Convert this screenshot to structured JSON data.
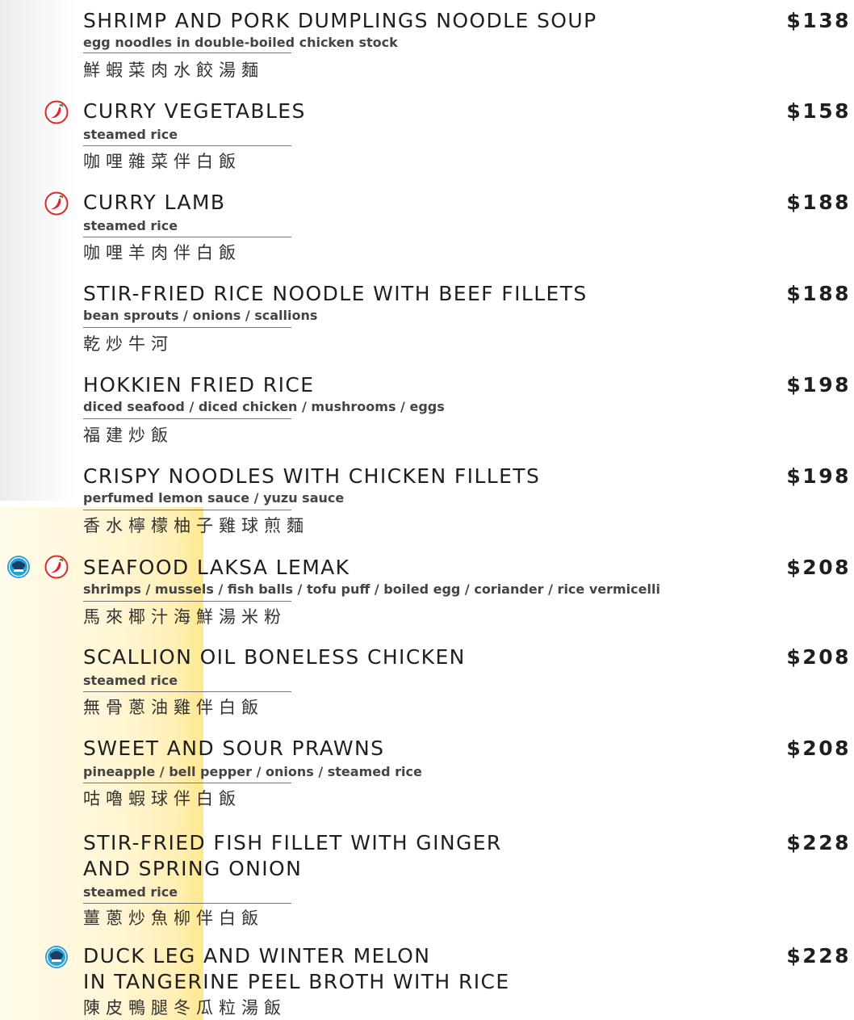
{
  "items": [
    {
      "title": "SHRIMP AND PORK DUMPLINGS NOODLE SOUP",
      "price": "$138",
      "desc": "egg noodles in double-boiled chicken stock",
      "cn": "鮮蝦菜肉水餃湯麵"
    },
    {
      "title": "CURRY VEGETABLES",
      "price": "$158",
      "desc": "steamed rice",
      "cn": "咖哩雜菜伴白飯",
      "icon": "chili-icon"
    },
    {
      "title": "CURRY LAMB",
      "price": "$188",
      "desc": "steamed rice",
      "cn": "咖哩羊肉伴白飯",
      "icon": "chili-icon"
    },
    {
      "title": "STIR-FRIED RICE NOODLE WITH BEEF FILLETS",
      "price": "$188",
      "desc": "bean sprouts / onions / scallions",
      "cn": "乾炒牛河"
    },
    {
      "title": "HOKKIEN FRIED RICE",
      "price": "$198",
      "desc": "diced seafood / diced chicken / mushrooms / eggs",
      "cn": "福建炒飯"
    },
    {
      "title": "CRISPY NOODLES WITH CHICKEN FILLETS",
      "price": "$198",
      "desc": "perfumed lemon sauce / yuzu sauce",
      "cn": "香水檸檬柚子雞球煎麵"
    },
    {
      "title": "SEAFOOD LAKSA LEMAK",
      "price": "$208",
      "desc": "shrimps / mussels / fish balls / tofu puff / boiled egg / coriander / rice vermicelli",
      "cn": "馬來椰汁海鮮湯米粉",
      "icons": [
        "chef-hat-icon",
        "chili-icon"
      ]
    },
    {
      "title": "SCALLION OIL BONELESS CHICKEN",
      "price": "$208",
      "desc": "steamed rice",
      "cn": "無骨蔥油雞伴白飯"
    },
    {
      "title": "SWEET AND SOUR PRAWNS",
      "price": "$208",
      "desc": "pineapple / bell pepper / onions / steamed rice",
      "cn": "咕嚕蝦球伴白飯"
    },
    {
      "title_line1": "STIR-FRIED FISH FILLET WITH GINGER",
      "title_line2": "AND SPRING ONION",
      "price": "$228",
      "desc": "steamed rice",
      "cn": "薑蔥炒魚柳伴白飯"
    },
    {
      "title_line1": "DUCK LEG AND WINTER MELON",
      "title_line2": "IN TANGERINE PEEL BROTH WITH RICE",
      "price": "$228",
      "cn": "陳皮鴨腿冬瓜粒湯飯",
      "icon": "chef-hat-icon"
    }
  ],
  "colors": {
    "chili": "#e0262b",
    "chef_badge": "#2a9fd8",
    "highlight": "#ffe88e"
  }
}
